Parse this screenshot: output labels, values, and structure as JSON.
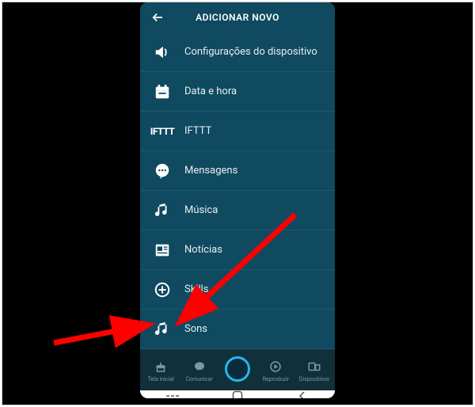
{
  "header": {
    "title": "ADICIONAR NOVO"
  },
  "list": {
    "items": [
      {
        "label": "Configurações do dispositivo",
        "icon": "speaker"
      },
      {
        "label": "Data e hora",
        "icon": "calendar"
      },
      {
        "label": "IFTTT",
        "icon": "ifttt"
      },
      {
        "label": "Mensagens",
        "icon": "chat"
      },
      {
        "label": "Música",
        "icon": "music"
      },
      {
        "label": "Notícias",
        "icon": "news"
      },
      {
        "label": "Skills",
        "icon": "plus-circle"
      },
      {
        "label": "Sons",
        "icon": "music"
      }
    ]
  },
  "bottomnav": {
    "items": [
      {
        "label": "Tela inicial"
      },
      {
        "label": "Comunicar"
      },
      {
        "label": ""
      },
      {
        "label": "Reproduzir"
      },
      {
        "label": "Dispositivos"
      }
    ]
  },
  "annotations": {
    "target": "Sons"
  }
}
